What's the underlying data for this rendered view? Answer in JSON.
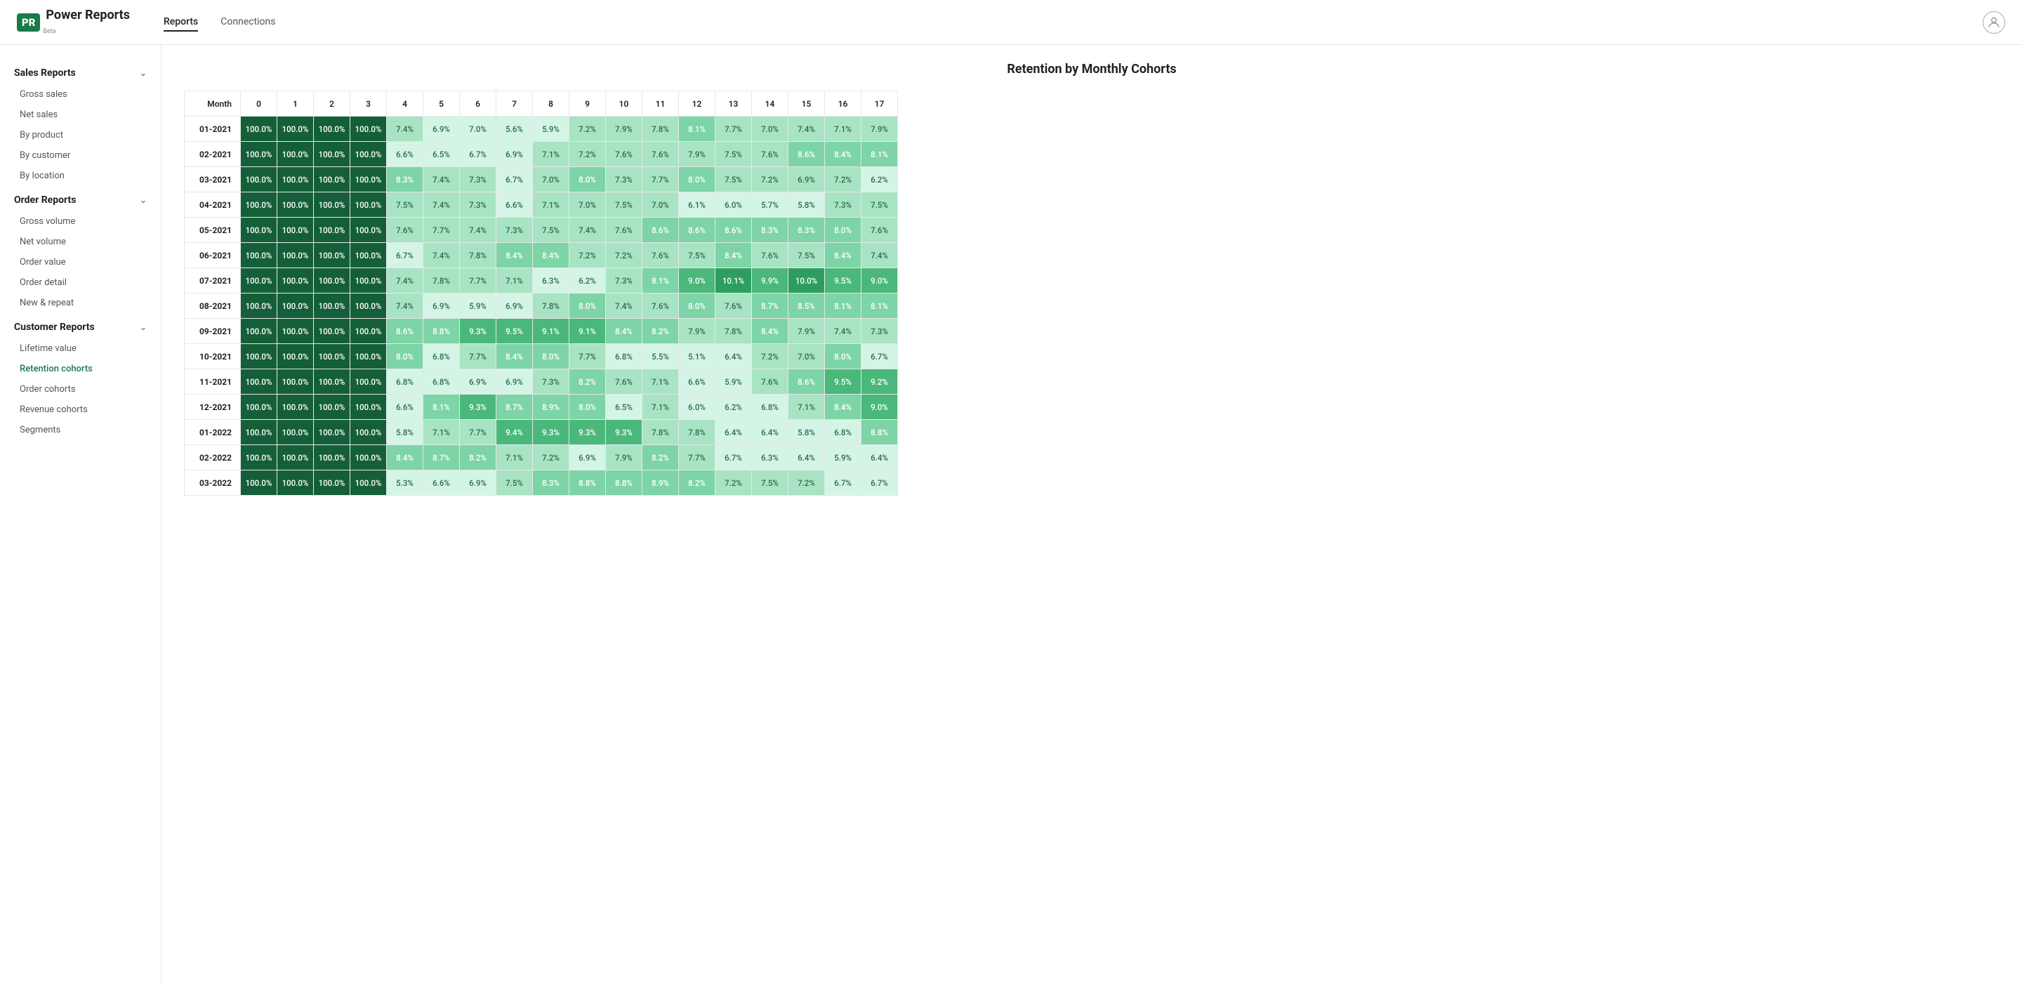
{
  "header": {
    "logo_text": "Power Reports",
    "logo_abbr": "PR",
    "logo_beta": "Beta",
    "nav": [
      {
        "label": "Reports",
        "active": true
      },
      {
        "label": "Connections",
        "active": false
      }
    ]
  },
  "sidebar": {
    "sections": [
      {
        "title": "Sales Reports",
        "items": [
          "Gross sales",
          "Net sales",
          "By product",
          "By customer",
          "By location"
        ]
      },
      {
        "title": "Order Reports",
        "items": [
          "Gross volume",
          "Net volume",
          "Order value",
          "Order detail",
          "New & repeat"
        ]
      },
      {
        "title": "Customer Reports",
        "items": [
          "Lifetime value",
          "Retention cohorts",
          "Order cohorts",
          "Revenue cohorts",
          "Segments"
        ]
      }
    ]
  },
  "report": {
    "title": "Retention by Monthly Cohorts",
    "columns": [
      "Month",
      "0",
      "1",
      "2",
      "3",
      "4",
      "5",
      "6",
      "7",
      "8",
      "9",
      "10",
      "11",
      "12",
      "13",
      "14",
      "15",
      "16",
      "17"
    ],
    "rows": [
      {
        "month": "01-2021",
        "values": [
          "100.0%",
          "100.0%",
          "100.0%",
          "100.0%",
          "7.4%",
          "6.9%",
          "7.0%",
          "5.6%",
          "5.9%",
          "7.2%",
          "7.9%",
          "7.8%",
          "8.1%",
          "7.7%",
          "7.0%",
          "7.4%",
          "7.1%",
          "7.9%"
        ],
        "classes": [
          "g-dark",
          "g-dark",
          "g-dark",
          "g-dark",
          "g-lighter",
          "g-lightest",
          "g-lightest",
          "g-lightest",
          "g-lightest",
          "g-lighter",
          "g-lighter",
          "g-lighter",
          "g-light",
          "g-lighter",
          "g-lighter",
          "g-lighter",
          "g-lighter",
          "g-lighter"
        ]
      },
      {
        "month": "02-2021",
        "values": [
          "100.0%",
          "100.0%",
          "100.0%",
          "100.0%",
          "6.6%",
          "6.5%",
          "6.7%",
          "6.9%",
          "7.1%",
          "7.2%",
          "7.6%",
          "7.6%",
          "7.9%",
          "7.5%",
          "7.6%",
          "8.6%",
          "8.4%",
          "8.1%"
        ],
        "classes": [
          "g-dark",
          "g-dark",
          "g-dark",
          "g-dark",
          "g-lightest",
          "g-lightest",
          "g-lightest",
          "g-lightest",
          "g-lighter",
          "g-lighter",
          "g-lighter",
          "g-lighter",
          "g-lighter",
          "g-lighter",
          "g-lighter",
          "g-light",
          "g-light",
          "g-light"
        ]
      },
      {
        "month": "03-2021",
        "values": [
          "100.0%",
          "100.0%",
          "100.0%",
          "100.0%",
          "8.3%",
          "7.4%",
          "7.3%",
          "6.7%",
          "7.0%",
          "8.0%",
          "7.3%",
          "7.7%",
          "8.0%",
          "7.5%",
          "7.2%",
          "6.9%",
          "7.2%",
          "6.2%"
        ],
        "classes": [
          "g-dark",
          "g-dark",
          "g-dark",
          "g-dark",
          "g-light",
          "g-lighter",
          "g-lighter",
          "g-lightest",
          "g-lighter",
          "g-light",
          "g-lighter",
          "g-lighter",
          "g-light",
          "g-lighter",
          "g-lighter",
          "g-lighter",
          "g-lighter",
          "g-lightest"
        ]
      },
      {
        "month": "04-2021",
        "values": [
          "100.0%",
          "100.0%",
          "100.0%",
          "100.0%",
          "7.5%",
          "7.4%",
          "7.3%",
          "6.6%",
          "7.1%",
          "7.0%",
          "7.5%",
          "7.0%",
          "6.1%",
          "6.0%",
          "5.7%",
          "5.8%",
          "7.3%",
          "7.5%"
        ],
        "classes": [
          "g-dark",
          "g-dark",
          "g-dark",
          "g-dark",
          "g-lighter",
          "g-lighter",
          "g-lighter",
          "g-lightest",
          "g-lighter",
          "g-lighter",
          "g-lighter",
          "g-lighter",
          "g-lightest",
          "g-lightest",
          "g-lightest",
          "g-lightest",
          "g-lighter",
          "g-lighter"
        ]
      },
      {
        "month": "05-2021",
        "values": [
          "100.0%",
          "100.0%",
          "100.0%",
          "100.0%",
          "7.6%",
          "7.7%",
          "7.4%",
          "7.3%",
          "7.5%",
          "7.4%",
          "7.6%",
          "8.6%",
          "8.6%",
          "8.6%",
          "8.3%",
          "8.3%",
          "8.0%",
          "7.6%"
        ],
        "classes": [
          "g-dark",
          "g-dark",
          "g-dark",
          "g-dark",
          "g-lighter",
          "g-lighter",
          "g-lighter",
          "g-lighter",
          "g-lighter",
          "g-lighter",
          "g-lighter",
          "g-light",
          "g-light",
          "g-light",
          "g-light",
          "g-light",
          "g-light",
          "g-lighter"
        ]
      },
      {
        "month": "06-2021",
        "values": [
          "100.0%",
          "100.0%",
          "100.0%",
          "100.0%",
          "6.7%",
          "7.4%",
          "7.8%",
          "8.4%",
          "8.4%",
          "7.2%",
          "7.2%",
          "7.6%",
          "7.5%",
          "8.4%",
          "7.6%",
          "7.5%",
          "8.4%",
          "7.4%"
        ],
        "classes": [
          "g-dark",
          "g-dark",
          "g-dark",
          "g-dark",
          "g-lightest",
          "g-lighter",
          "g-lighter",
          "g-light",
          "g-light",
          "g-lighter",
          "g-lighter",
          "g-lighter",
          "g-lighter",
          "g-light",
          "g-lighter",
          "g-lighter",
          "g-light",
          "g-lighter"
        ]
      },
      {
        "month": "07-2021",
        "values": [
          "100.0%",
          "100.0%",
          "100.0%",
          "100.0%",
          "7.4%",
          "7.8%",
          "7.7%",
          "7.1%",
          "6.3%",
          "6.2%",
          "7.3%",
          "8.1%",
          "9.0%",
          "10.1%",
          "9.9%",
          "10.0%",
          "9.5%",
          "9.0%"
        ],
        "classes": [
          "g-dark",
          "g-dark",
          "g-dark",
          "g-dark",
          "g-lighter",
          "g-lighter",
          "g-lighter",
          "g-lighter",
          "g-lightest",
          "g-lightest",
          "g-lighter",
          "g-light",
          "g-med-light",
          "g-med",
          "g-med-light",
          "g-med",
          "g-med-light",
          "g-med-light"
        ]
      },
      {
        "month": "08-2021",
        "values": [
          "100.0%",
          "100.0%",
          "100.0%",
          "100.0%",
          "7.4%",
          "6.9%",
          "5.9%",
          "6.9%",
          "7.8%",
          "8.0%",
          "7.4%",
          "7.6%",
          "8.0%",
          "7.6%",
          "8.7%",
          "8.5%",
          "8.1%",
          "8.1%"
        ],
        "classes": [
          "g-dark",
          "g-dark",
          "g-dark",
          "g-dark",
          "g-lighter",
          "g-lightest",
          "g-lightest",
          "g-lightest",
          "g-lighter",
          "g-light",
          "g-lighter",
          "g-lighter",
          "g-light",
          "g-lighter",
          "g-light",
          "g-light",
          "g-light",
          "g-light"
        ]
      },
      {
        "month": "09-2021",
        "values": [
          "100.0%",
          "100.0%",
          "100.0%",
          "100.0%",
          "8.6%",
          "8.8%",
          "9.3%",
          "9.5%",
          "9.1%",
          "9.1%",
          "8.4%",
          "8.2%",
          "7.9%",
          "7.8%",
          "8.4%",
          "7.9%",
          "7.4%",
          "7.3%"
        ],
        "classes": [
          "g-dark",
          "g-dark",
          "g-dark",
          "g-dark",
          "g-light",
          "g-light",
          "g-med-light",
          "g-med-light",
          "g-med-light",
          "g-med-light",
          "g-light",
          "g-light",
          "g-lighter",
          "g-lighter",
          "g-light",
          "g-lighter",
          "g-lighter",
          "g-lighter"
        ]
      },
      {
        "month": "10-2021",
        "values": [
          "100.0%",
          "100.0%",
          "100.0%",
          "100.0%",
          "8.0%",
          "6.8%",
          "7.7%",
          "8.4%",
          "8.0%",
          "7.7%",
          "6.8%",
          "5.5%",
          "5.1%",
          "6.4%",
          "7.2%",
          "7.0%",
          "8.0%",
          "6.7%"
        ],
        "classes": [
          "g-dark",
          "g-dark",
          "g-dark",
          "g-dark",
          "g-light",
          "g-lightest",
          "g-lighter",
          "g-light",
          "g-light",
          "g-lighter",
          "g-lightest",
          "g-lightest",
          "g-lightest",
          "g-lightest",
          "g-lighter",
          "g-lighter",
          "g-light",
          "g-lightest"
        ]
      },
      {
        "month": "11-2021",
        "values": [
          "100.0%",
          "100.0%",
          "100.0%",
          "100.0%",
          "6.8%",
          "6.8%",
          "6.9%",
          "6.9%",
          "7.3%",
          "8.2%",
          "7.6%",
          "7.1%",
          "6.6%",
          "5.9%",
          "7.6%",
          "8.6%",
          "9.5%",
          "9.2%"
        ],
        "classes": [
          "g-dark",
          "g-dark",
          "g-dark",
          "g-dark",
          "g-lightest",
          "g-lightest",
          "g-lightest",
          "g-lightest",
          "g-lighter",
          "g-light",
          "g-lighter",
          "g-lighter",
          "g-lightest",
          "g-lightest",
          "g-lighter",
          "g-light",
          "g-med-light",
          "g-med-light"
        ]
      },
      {
        "month": "12-2021",
        "values": [
          "100.0%",
          "100.0%",
          "100.0%",
          "100.0%",
          "6.6%",
          "8.1%",
          "9.3%",
          "8.7%",
          "8.9%",
          "8.0%",
          "6.5%",
          "7.1%",
          "6.0%",
          "6.2%",
          "6.8%",
          "7.1%",
          "8.4%",
          "9.0%"
        ],
        "classes": [
          "g-dark",
          "g-dark",
          "g-dark",
          "g-dark",
          "g-lightest",
          "g-light",
          "g-med-light",
          "g-light",
          "g-light",
          "g-light",
          "g-lightest",
          "g-lighter",
          "g-lightest",
          "g-lightest",
          "g-lightest",
          "g-lighter",
          "g-light",
          "g-med-light"
        ]
      },
      {
        "month": "01-2022",
        "values": [
          "100.0%",
          "100.0%",
          "100.0%",
          "100.0%",
          "5.8%",
          "7.1%",
          "7.7%",
          "9.4%",
          "9.3%",
          "9.3%",
          "9.3%",
          "7.8%",
          "7.8%",
          "6.4%",
          "6.4%",
          "5.8%",
          "6.8%",
          "8.8%"
        ],
        "classes": [
          "g-dark",
          "g-dark",
          "g-dark",
          "g-dark",
          "g-lightest",
          "g-lighter",
          "g-lighter",
          "g-med-light",
          "g-med-light",
          "g-med-light",
          "g-med-light",
          "g-lighter",
          "g-lighter",
          "g-lightest",
          "g-lightest",
          "g-lightest",
          "g-lightest",
          "g-light"
        ]
      },
      {
        "month": "02-2022",
        "values": [
          "100.0%",
          "100.0%",
          "100.0%",
          "100.0%",
          "8.4%",
          "8.7%",
          "8.2%",
          "7.1%",
          "7.2%",
          "6.9%",
          "7.9%",
          "8.2%",
          "7.7%",
          "6.7%",
          "6.3%",
          "6.4%",
          "5.9%",
          "6.4%"
        ],
        "classes": [
          "g-dark",
          "g-dark",
          "g-dark",
          "g-dark",
          "g-light",
          "g-light",
          "g-light",
          "g-lighter",
          "g-lighter",
          "g-lightest",
          "g-lighter",
          "g-light",
          "g-lighter",
          "g-lightest",
          "g-lightest",
          "g-lightest",
          "g-lightest",
          "g-lightest"
        ]
      },
      {
        "month": "03-2022",
        "values": [
          "100.0%",
          "100.0%",
          "100.0%",
          "100.0%",
          "5.3%",
          "6.6%",
          "6.9%",
          "7.5%",
          "8.3%",
          "8.8%",
          "8.8%",
          "8.9%",
          "8.2%",
          "7.2%",
          "7.5%",
          "7.2%",
          "6.7%",
          "6.7%"
        ],
        "classes": [
          "g-dark",
          "g-dark",
          "g-dark",
          "g-dark",
          "g-lightest",
          "g-lightest",
          "g-lightest",
          "g-lighter",
          "g-light",
          "g-light",
          "g-light",
          "g-light",
          "g-light",
          "g-lighter",
          "g-lighter",
          "g-lighter",
          "g-lightest",
          "g-lightest"
        ]
      }
    ]
  }
}
